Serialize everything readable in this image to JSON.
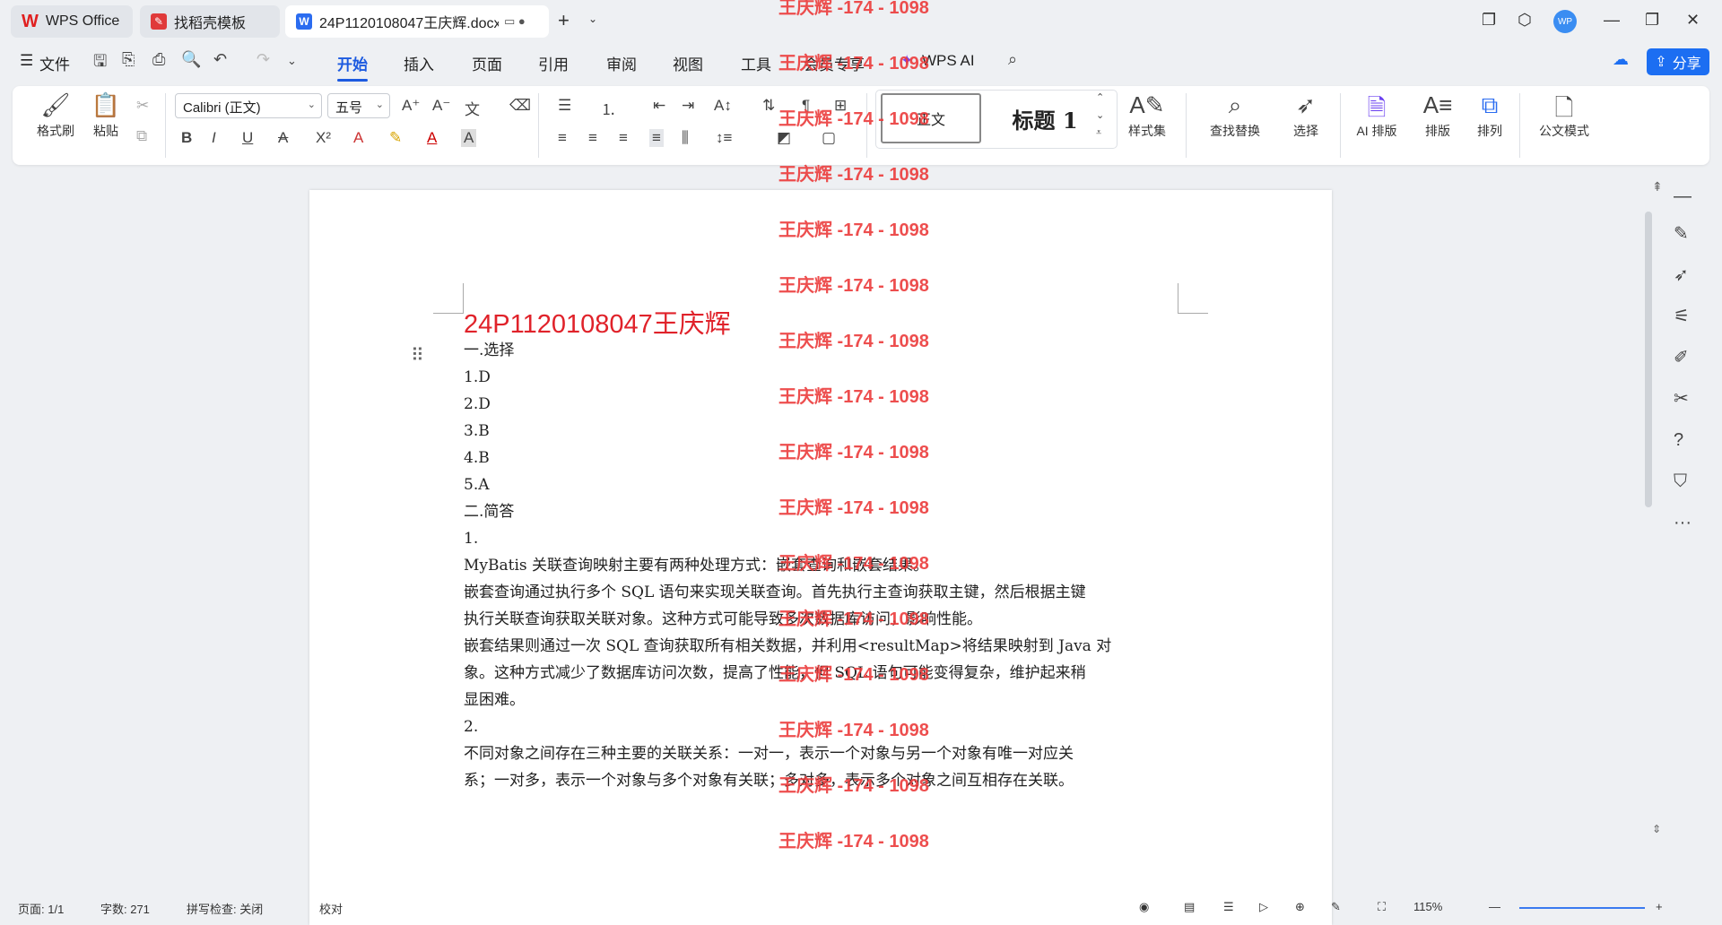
{
  "tabs": [
    {
      "label": "WPS Office",
      "icon": "wps-logo-icon"
    },
    {
      "label": "找稻壳模板",
      "icon": "docer-icon"
    },
    {
      "label": "24P1120108047王庆辉.docx",
      "icon": "word-doc-icon"
    }
  ],
  "menu": {
    "file": "文件",
    "items": [
      "开始",
      "插入",
      "页面",
      "引用",
      "审阅",
      "视图",
      "工具",
      "会员专享",
      "WPS AI"
    ],
    "share": "分享",
    "avatar": "WP"
  },
  "ribbon": {
    "format_painter": "格式刷",
    "paste": "粘贴",
    "font_name": "Calibri (正文)",
    "font_size": "五号",
    "style_normal": "正文",
    "style_heading": "标题 1",
    "style_set": "样式集",
    "find_replace": "查找替换",
    "select": "选择",
    "ai_layout": "AI 排版",
    "layout": "排版",
    "arrange": "排列",
    "official_mode": "公文模式"
  },
  "document": {
    "title": "24P1120108047王庆辉",
    "lines": [
      "一.选择",
      "1.D",
      "2.D",
      "3.B",
      "4.B",
      "5.A",
      "二.简答",
      "1.",
      "MyBatis 关联查询映射主要有两种处理方式：嵌套查询和嵌套结果。",
      "嵌套查询通过执行多个 SQL 语句来实现关联查询。首先执行主查询获取主键，然后根据主键",
      "执行关联查询获取关联对象。这种方式可能导致多次数据库访问，影响性能。",
      "嵌套结果则通过一次 SQL 查询获取所有相关数据，并利用<resultMap>将结果映射到 Java 对",
      "象。这种方式减少了数据库访问次数，提高了性能，但 SQL 语句可能变得复杂，维护起来稍",
      "显困难。",
      "2.",
      "不同对象之间存在三种主要的关联关系：一对一，表示一个对象与另一个对象有唯一对应关",
      "系；一对多，表示一个对象与多个对象有关联；多对多，表示多个对象之间互相存在关联。"
    ],
    "watermark": "王庆辉 -174 - 1098"
  },
  "status": {
    "page": "页面: 1/1",
    "words": "字数: 271",
    "spell": "拼写检查: 关闭",
    "proof": "校对",
    "zoom": "115%"
  }
}
